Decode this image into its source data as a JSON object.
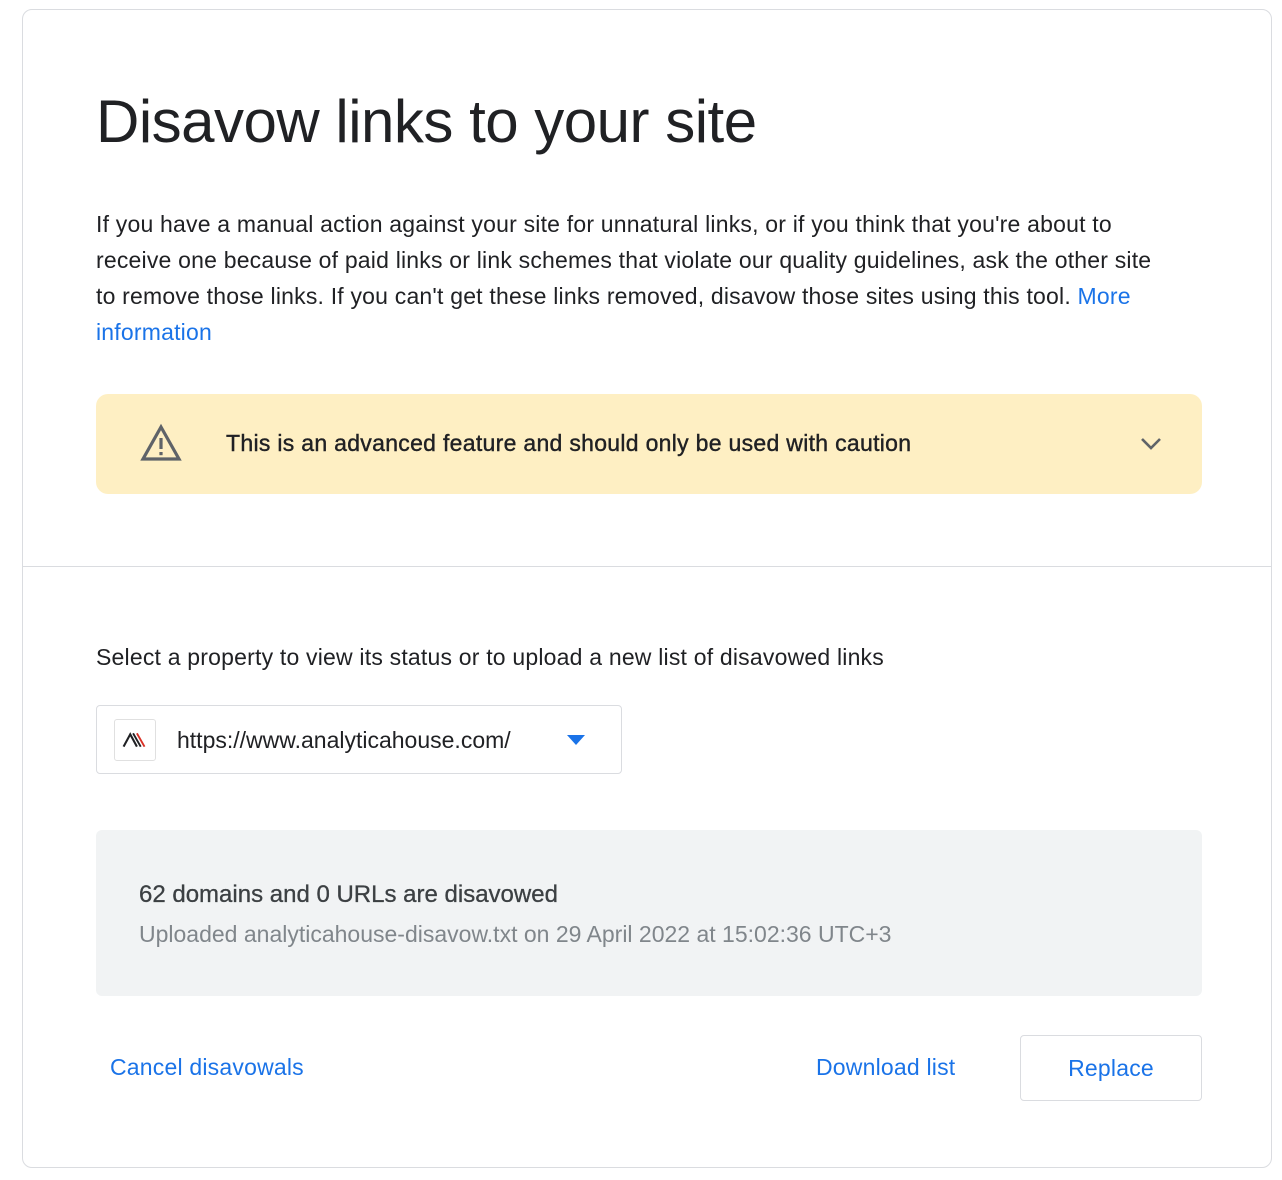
{
  "page": {
    "title": "Disavow links to your site",
    "description_text": "If you have a manual action against your site for unnatural links, or if you think that you're about to receive one because of paid links or link schemes that violate our quality guidelines, ask the other site to remove those links. If you can't get these links removed, disavow those sites using this tool. ",
    "more_info_link": "More information"
  },
  "warning": {
    "text": "This is an advanced feature and should only be used with caution",
    "icon": "warning-triangle-icon",
    "expand_icon": "chevron-down-icon",
    "background_color": "#feefc3"
  },
  "property": {
    "label": "Select a property to view its status or to upload a new list of disavowed links",
    "selected_url": "https://www.analyticahouse.com/",
    "favicon": "analyticahouse-logo",
    "dropdown_icon": "dropdown-arrow-icon"
  },
  "status": {
    "title": "62 domains and 0 URLs are disavowed",
    "subtitle": "Uploaded analyticahouse-disavow.txt on 29 April 2022 at 15:02:36 UTC+3"
  },
  "actions": {
    "cancel_label": "Cancel disavowals",
    "download_label": "Download list",
    "replace_label": "Replace"
  },
  "colors": {
    "accent": "#1a73e8",
    "text": "#202124",
    "muted": "#80868b"
  }
}
